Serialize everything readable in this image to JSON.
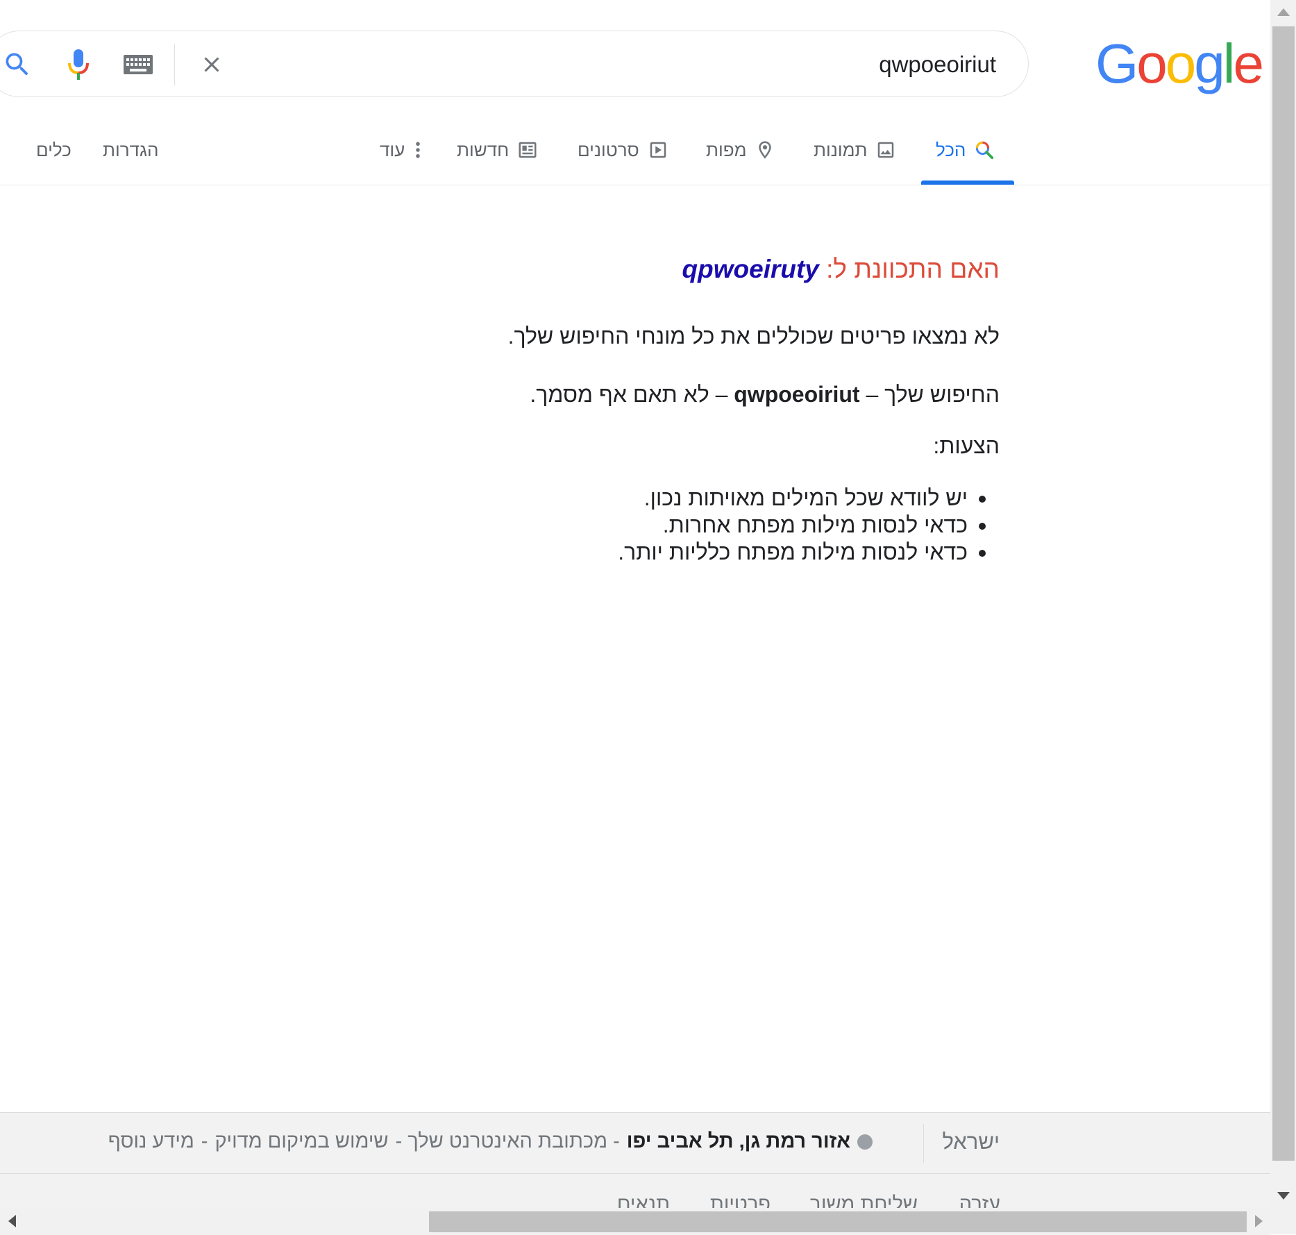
{
  "logo": {
    "letters": [
      "G",
      "o",
      "o",
      "g",
      "l",
      "e"
    ],
    "colors": [
      "#4285f4",
      "#ea4335",
      "#fbbc05",
      "#4285f4",
      "#34a853",
      "#ea4335"
    ]
  },
  "search": {
    "value": "qwpoeoiriut",
    "icons": [
      "search-icon",
      "mic-icon",
      "keyboard-icon",
      "clear-icon"
    ]
  },
  "tabs": {
    "all": "הכל",
    "images": "תמונות",
    "maps": "מפות",
    "videos": "סרטונים",
    "news": "חדשות",
    "more": "עוד",
    "settings": "הגדרות",
    "tools": "כלים",
    "active": "all",
    "accent": "#1a73e8"
  },
  "results": {
    "did_you_mean_prefix": "האם התכוונת ל:",
    "did_you_mean_query": "qpwoeiruty",
    "no_results": "לא נמצאו פריטים שכוללים את כל מונחי החיפוש שלך.",
    "your_search_prefix": "החיפוש שלך –",
    "your_search_query": "qwpoeoiriut",
    "your_search_suffix": "– לא תאם אף מסמך.",
    "suggestions_title": "הצעות:",
    "suggestions": [
      "יש לוודא שכל המילים מאויתות נכון.",
      "כדאי לנסות מילות מפתח אחרות.",
      "כדאי לנסות מילות מפתח כלליות יותר."
    ]
  },
  "footer": {
    "country": "ישראל",
    "location": "אזור רמת גן, תל אביב יפו",
    "location_source": "- מכתובת האינטרנט שלך -",
    "use_precise": "שימוש במיקום מדויק",
    "separator": "-",
    "learn_more": "מידע נוסף",
    "links": [
      "עזרה",
      "שליחת משוב",
      "פרטיות",
      "תנאים"
    ]
  }
}
